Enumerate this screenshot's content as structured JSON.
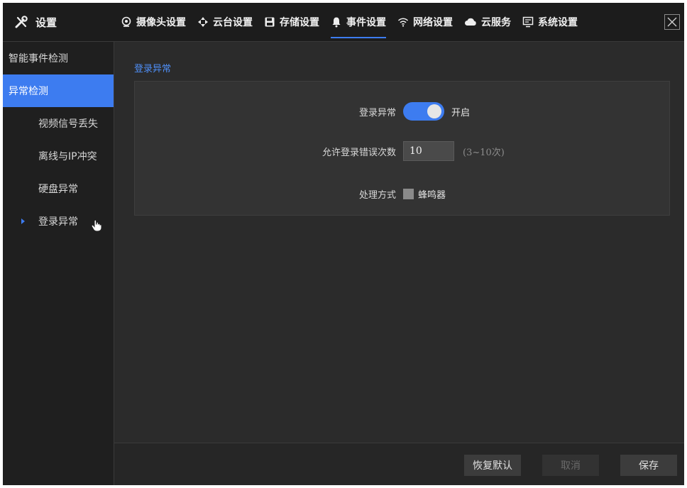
{
  "header": {
    "title": "设置",
    "tabs": [
      {
        "label": "摄像头设置",
        "icon": "camera-icon"
      },
      {
        "label": "云台设置",
        "icon": "ptz-arrows-icon"
      },
      {
        "label": "存储设置",
        "icon": "save-disk-icon"
      },
      {
        "label": "事件设置",
        "icon": "bell-icon",
        "active": true
      },
      {
        "label": "网络设置",
        "icon": "wifi-icon"
      },
      {
        "label": "云服务",
        "icon": "cloud-icon"
      },
      {
        "label": "系统设置",
        "icon": "monitor-icon"
      }
    ]
  },
  "sidebar": {
    "items": [
      {
        "label": "智能事件检测"
      },
      {
        "label": "异常检测",
        "active": true
      },
      {
        "label": "视频信号丢失"
      },
      {
        "label": "离线与IP冲突"
      },
      {
        "label": "硬盘异常"
      },
      {
        "label": "登录异常",
        "selected": true
      }
    ]
  },
  "main": {
    "section_title": "登录异常",
    "login_exception": {
      "label": "登录异常",
      "state_text": "开启",
      "enabled": true
    },
    "allowed_errors": {
      "label": "允许登录错误次数",
      "value": "10",
      "range_hint": "(3~10次)"
    },
    "handling": {
      "label": "处理方式",
      "option_label": "蜂鸣器",
      "checked": false
    }
  },
  "footer": {
    "restore_label": "恢复默认",
    "cancel_label": "取消",
    "save_label": "保存"
  },
  "colors": {
    "accent": "#3d7cf0",
    "background": "#2b2b2b"
  }
}
